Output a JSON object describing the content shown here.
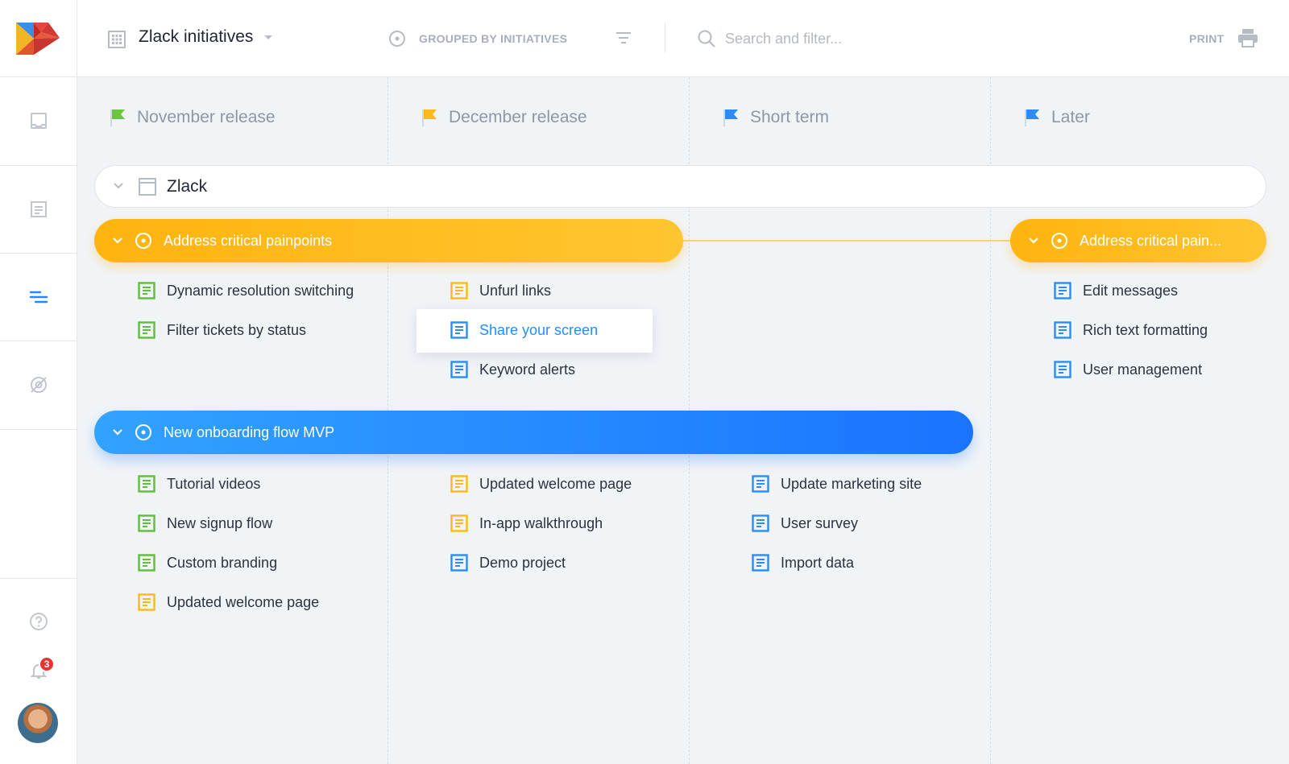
{
  "header": {
    "board_title": "Zlack initiatives",
    "grouping_label": "GROUPED BY INITIATIVES",
    "search_placeholder": "Search and filter...",
    "print_label": "PRINT"
  },
  "sidebar": {
    "notification_count": "3",
    "nav_icons": [
      "inbox-icon",
      "document-icon",
      "roadmap-icon",
      "hidden-eye-icon"
    ],
    "bottom_icons": [
      "help-icon",
      "bell-icon",
      "avatar"
    ]
  },
  "columns": [
    {
      "title": "November release",
      "flag_color": "#6cc63a"
    },
    {
      "title": "December release",
      "flag_color": "#ffb81c"
    },
    {
      "title": "Short term",
      "flag_color": "#2b8cf5"
    },
    {
      "title": "Later",
      "flag_color": "#2b8cf5"
    }
  ],
  "product": {
    "name": "Zlack"
  },
  "initiatives": [
    {
      "label": "Address critical painpoints",
      "color": "#ffb81c"
    },
    {
      "label": "Address critical pain...",
      "color": "#ffb81c"
    },
    {
      "label": "New onboarding flow MVP",
      "color": "#2288ff"
    }
  ],
  "features": {
    "painpoints_nov": [
      {
        "label": "Dynamic resolution switching",
        "status": "green"
      },
      {
        "label": "Filter tickets by status",
        "status": "green"
      }
    ],
    "painpoints_dec": [
      {
        "label": "Unfurl links",
        "status": "yellow"
      },
      {
        "label": "Share your screen",
        "status": "blue",
        "active": true
      },
      {
        "label": "Keyword alerts",
        "status": "blue"
      }
    ],
    "painpoints_later": [
      {
        "label": "Edit messages",
        "status": "blue"
      },
      {
        "label": "Rich text formatting",
        "status": "blue"
      },
      {
        "label": "User management",
        "status": "blue"
      }
    ],
    "onboarding_nov": [
      {
        "label": "Tutorial videos",
        "status": "green"
      },
      {
        "label": "New signup flow",
        "status": "green"
      },
      {
        "label": "Custom branding",
        "status": "green"
      },
      {
        "label": "Updated welcome page",
        "status": "yellow"
      }
    ],
    "onboarding_dec": [
      {
        "label": "Updated welcome page",
        "status": "yellow"
      },
      {
        "label": "In-app walkthrough",
        "status": "yellow"
      },
      {
        "label": "Demo project",
        "status": "blue"
      }
    ],
    "onboarding_short": [
      {
        "label": "Update marketing site",
        "status": "blue"
      },
      {
        "label": "User survey",
        "status": "blue"
      },
      {
        "label": "Import data",
        "status": "blue"
      }
    ]
  },
  "status_colors": {
    "green": "#5fbf3a",
    "yellow": "#ffb81c",
    "blue": "#2b8cf5"
  }
}
